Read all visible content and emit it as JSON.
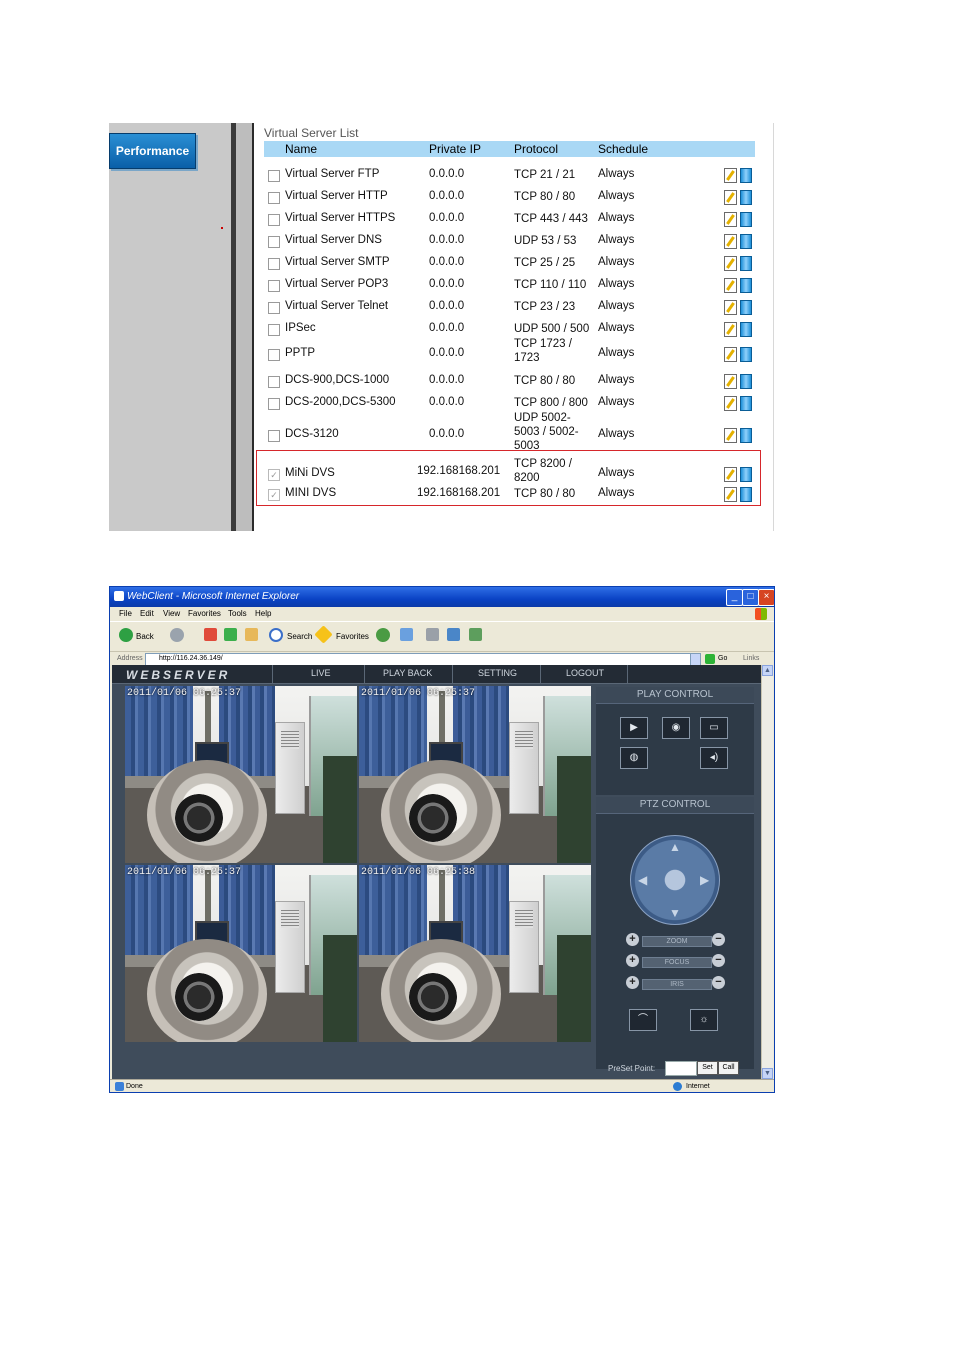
{
  "router": {
    "performance_button": "Performance",
    "title": "Virtual Server List",
    "headers": {
      "name": "Name",
      "private_ip": "Private IP",
      "protocol": "Protocol",
      "schedule": "Schedule"
    },
    "rows": [
      {
        "name": "Virtual Server FTP",
        "ip": "0.0.0.0",
        "protocol": "TCP 21 / 21",
        "schedule": "Always",
        "checked": false
      },
      {
        "name": "Virtual Server HTTP",
        "ip": "0.0.0.0",
        "protocol": "TCP 80 / 80",
        "schedule": "Always",
        "checked": false
      },
      {
        "name": "Virtual Server HTTPS",
        "ip": "0.0.0.0",
        "protocol": "TCP 443 / 443",
        "schedule": "Always",
        "checked": false
      },
      {
        "name": "Virtual Server DNS",
        "ip": "0.0.0.0",
        "protocol": "UDP 53 / 53",
        "schedule": "Always",
        "checked": false
      },
      {
        "name": "Virtual Server SMTP",
        "ip": "0.0.0.0",
        "protocol": "TCP 25 / 25",
        "schedule": "Always",
        "checked": false
      },
      {
        "name": "Virtual Server POP3",
        "ip": "0.0.0.0",
        "protocol": "TCP 110 / 110",
        "schedule": "Always",
        "checked": false
      },
      {
        "name": "Virtual Server Telnet",
        "ip": "0.0.0.0",
        "protocol": "TCP 23 / 23",
        "schedule": "Always",
        "checked": false
      },
      {
        "name": "IPSec",
        "ip": "0.0.0.0",
        "protocol": "UDP 500 / 500",
        "schedule": "Always",
        "checked": false
      },
      {
        "name": "PPTP",
        "ip": "0.0.0.0",
        "protocol": "TCP 1723 / 1723",
        "schedule": "Always",
        "checked": false
      },
      {
        "name": "DCS-900,DCS-1000",
        "ip": "0.0.0.0",
        "protocol": "TCP 80 / 80",
        "schedule": "Always",
        "checked": false
      },
      {
        "name": "DCS-2000,DCS-5300",
        "ip": "0.0.0.0",
        "protocol": "TCP 800 / 800",
        "schedule": "Always",
        "checked": false
      },
      {
        "name": "DCS-3120",
        "ip": "0.0.0.0",
        "protocol": "UDP 5002-5003 / 5002-5003",
        "schedule": "Always",
        "checked": false
      },
      {
        "name": "MiNi DVS",
        "ip": "192.168168.201",
        "protocol": "TCP 8200 / 8200",
        "schedule": "Always",
        "checked": true
      },
      {
        "name": "MINI DVS",
        "ip": "192.168168.201",
        "protocol": "TCP 80 / 80",
        "schedule": "Always",
        "checked": true
      }
    ],
    "edit_icon": "edit-icon",
    "delete_icon": "trash-icon",
    "highlight_color": "#d6272b"
  },
  "browser": {
    "title": "WebClient - Microsoft Internet Explorer",
    "menu": [
      "File",
      "Edit",
      "View",
      "Favorites",
      "Tools",
      "Help"
    ],
    "toolbar": {
      "back": "Back",
      "search": "Search",
      "favorites": "Favorites"
    },
    "address_label": "Address",
    "address": "http://116.24.36.149/",
    "go": "Go",
    "links": "Links",
    "status": "Done",
    "zone": "Internet"
  },
  "webserver": {
    "logo": "WEBSERVER",
    "nav": [
      "LIVE",
      "PLAY BACK",
      "SETTING",
      "LOGOUT"
    ],
    "cameras": [
      {
        "timestamp": "2011/01/06 06:25:37",
        "selected": true
      },
      {
        "timestamp": "2011/01/06 06:25:37",
        "selected": false
      },
      {
        "timestamp": "2011/01/06 06:25:37",
        "selected": false
      },
      {
        "timestamp": "2011/01/06 06:25:38",
        "selected": false
      }
    ],
    "play_control_title": "PLAY CONTROL",
    "ptz_control_title": "PTZ CONTROL",
    "ptz_rows": [
      "ZOOM",
      "FOCUS",
      "IRIS"
    ],
    "preset_label": "PreSet Point:",
    "preset_value": "",
    "set_button": "Set",
    "call_button": "Call",
    "selected_color": "#2bbd2b"
  }
}
